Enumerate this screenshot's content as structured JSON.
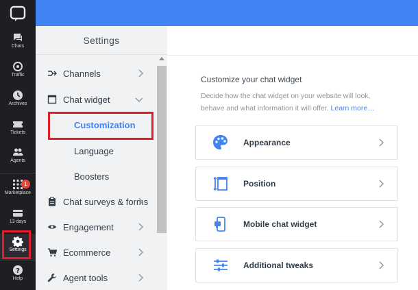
{
  "rail": {
    "items": [
      {
        "label": "Chats"
      },
      {
        "label": "Traffic"
      },
      {
        "label": "Archives"
      },
      {
        "label": "Tickets"
      },
      {
        "label": "Agents"
      },
      {
        "label": "Marketplace",
        "badge": "1"
      },
      {
        "label": "13 days"
      },
      {
        "label": "Settings"
      },
      {
        "label": "Help"
      }
    ]
  },
  "settings": {
    "title": "Settings",
    "nav": [
      {
        "label": "Channels"
      },
      {
        "label": "Chat widget"
      },
      {
        "label": "Chat surveys & forms"
      },
      {
        "label": "Engagement"
      },
      {
        "label": "Ecommerce"
      },
      {
        "label": "Agent tools"
      }
    ],
    "subnav": [
      {
        "label": "Customization"
      },
      {
        "label": "Language"
      },
      {
        "label": "Boosters"
      }
    ]
  },
  "main": {
    "title": "Customize your chat widget",
    "desc": "Decide how the chat widget on your website will look, behave and what information it will offer.",
    "link": "Learn more…",
    "cards": [
      {
        "label": "Appearance",
        "icon": "palette-icon"
      },
      {
        "label": "Position",
        "icon": "position-icon"
      },
      {
        "label": "Mobile chat widget",
        "icon": "mobile-icon"
      },
      {
        "label": "Additional tweaks",
        "icon": "sliders-icon"
      }
    ]
  },
  "colors": {
    "accent": "#4384f5",
    "highlight": "#e11d2b",
    "rail": "#1f1f23"
  }
}
